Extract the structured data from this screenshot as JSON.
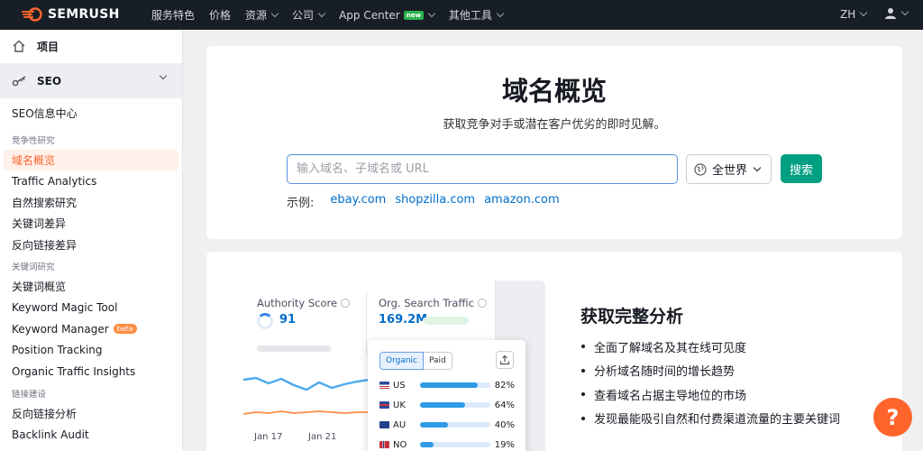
{
  "brand": {
    "name": "SEMRUSH",
    "accent": "#ff642d",
    "search_button_color": "#009f81",
    "link_color": "#006dca"
  },
  "topnav": {
    "items": [
      {
        "label": "服务特色",
        "has_menu": false
      },
      {
        "label": "价格",
        "has_menu": false
      },
      {
        "label": "资源",
        "has_menu": true
      },
      {
        "label": "公司",
        "has_menu": true
      },
      {
        "label": "App Center",
        "has_menu": true,
        "badge": "new"
      },
      {
        "label": "其他工具",
        "has_menu": true
      }
    ],
    "language": "ZH",
    "user_icon": "user-icon"
  },
  "sidebar": {
    "project_label": "项目",
    "seo_label": "SEO",
    "seo_home": "SEO信息中心",
    "groups": [
      {
        "title": "竞争性研究",
        "items": [
          "域名概览",
          "Traffic Analytics",
          "自然搜索研究",
          "关键词差异",
          "反向链接差异"
        ]
      },
      {
        "title": "关键词研究",
        "items": [
          "关键词概览",
          "Keyword Magic Tool",
          "Keyword Manager",
          "Position Tracking",
          "Organic Traffic Insights"
        ]
      },
      {
        "title": "链接建设",
        "items": [
          "反向链接分析",
          "Backlink Audit"
        ]
      }
    ],
    "active_item": "域名概览",
    "beta_badge": "beta"
  },
  "hero": {
    "title": "域名概览",
    "subtitle": "获取竞争对手或潜在客户优劣的即时见解。",
    "search_placeholder": "输入域名、子域名或 URL",
    "region": "全世界",
    "search_button": "搜索",
    "examples_label": "示例:",
    "examples": [
      "ebay.com",
      "shopzilla.com",
      "amazon.com"
    ]
  },
  "feature": {
    "title": "获取完整分析",
    "bullets": [
      "全面了解域名及其在线可见度",
      "分析域名随时间的增长趋势",
      "查看域名占据主导地位的市场",
      "发现最能吸引自然和付费渠道流量的主要关键词"
    ]
  },
  "preview": {
    "authority_label": "Authority Score",
    "authority_value": "91",
    "traffic_label": "Org. Search Traffic",
    "traffic_value": "169.2M",
    "dates": [
      "Jan 17",
      "Jan 21"
    ],
    "tabs": [
      "Organic",
      "Paid"
    ],
    "countries": [
      {
        "code": "US",
        "pct": "82%",
        "share": 0.82
      },
      {
        "code": "UK",
        "pct": "64%",
        "share": 0.64
      },
      {
        "code": "AU",
        "pct": "40%",
        "share": 0.4
      },
      {
        "code": "NO",
        "pct": "19%",
        "share": 0.19
      }
    ]
  },
  "help_label": "?"
}
